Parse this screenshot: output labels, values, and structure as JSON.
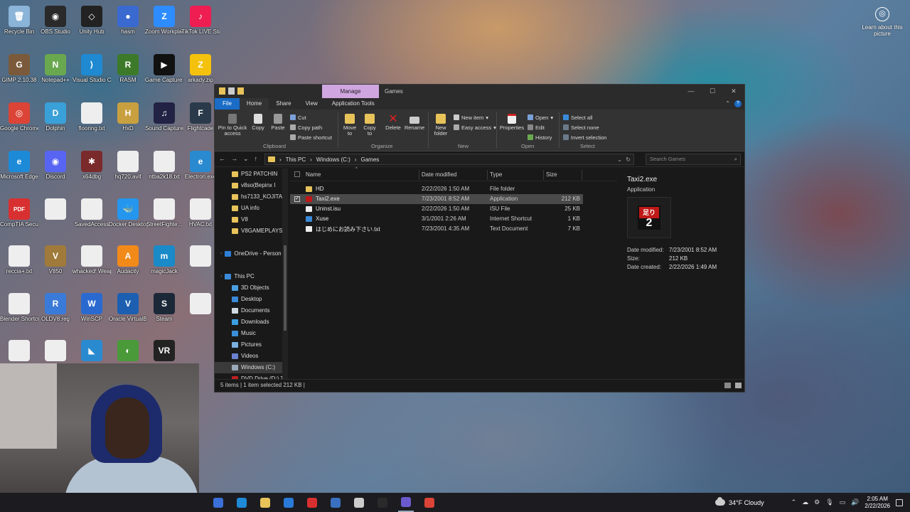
{
  "desktop": {
    "icons": [
      {
        "label": "Recycle Bin",
        "color": "#8ab4d8",
        "glyph": "🗑"
      },
      {
        "label": "OBS Studio",
        "color": "#2a2a2a",
        "glyph": "◉"
      },
      {
        "label": "Unity Hub",
        "color": "#222222",
        "glyph": "◇"
      },
      {
        "label": "hasm",
        "color": "#3a6ad0",
        "glyph": "●"
      },
      {
        "label": "Zoom Workplace",
        "color": "#2d8cff",
        "glyph": "Z"
      },
      {
        "label": "TikTok LIVE Studio",
        "color": "#ee1d52",
        "glyph": "♪"
      },
      {
        "label": "GIMP 2.10.38",
        "color": "#7a5a3a",
        "glyph": "G"
      },
      {
        "label": "Notepad++",
        "color": "#6aa84f",
        "glyph": "N"
      },
      {
        "label": "Visual Studio Code",
        "color": "#1f8ad2",
        "glyph": "⟩"
      },
      {
        "label": "RASM",
        "color": "#3c7a2a",
        "glyph": "R"
      },
      {
        "label": "Game Capture HD",
        "color": "#111111",
        "glyph": "▶"
      },
      {
        "label": "arkady.zip",
        "color": "#f4c20d",
        "glyph": "Z"
      },
      {
        "label": "Google Chrome",
        "color": "#db4437",
        "glyph": "◎"
      },
      {
        "label": "Dolphin",
        "color": "#3aa0d8",
        "glyph": "D"
      },
      {
        "label": "flooring.txt",
        "color": "#eeeeee",
        "glyph": ""
      },
      {
        "label": "HxD",
        "color": "#c8a040",
        "glyph": "H"
      },
      {
        "label": "Sound Capture",
        "color": "#222244",
        "glyph": "♫"
      },
      {
        "label": "Flightcade",
        "color": "#2a3a4a",
        "glyph": "F"
      },
      {
        "label": "Microsoft Edge",
        "color": "#1d8ad8",
        "glyph": "e"
      },
      {
        "label": "Discord",
        "color": "#5865f2",
        "glyph": "◉"
      },
      {
        "label": "x64dbg",
        "color": "#7a2a2a",
        "glyph": "✱"
      },
      {
        "label": "hq720.avif",
        "color": "#eeeeee",
        "glyph": ""
      },
      {
        "label": "ntba2k18.txt",
        "color": "#eeeeee",
        "glyph": ""
      },
      {
        "label": "Electron.exe",
        "color": "#2a8ad0",
        "glyph": "e"
      },
      {
        "label": "CompTIA Security...",
        "color": "#d83030",
        "glyph": "PDF"
      },
      {
        "label": "",
        "color": "#eeeeee",
        "glyph": ""
      },
      {
        "label": "SavedAccess",
        "color": "#eeeeee",
        "glyph": ""
      },
      {
        "label": "Docker Desktop",
        "color": "#2496ed",
        "glyph": "🐳"
      },
      {
        "label": "StreetFighte...",
        "color": "#eeeeee",
        "glyph": ""
      },
      {
        "label": "HVAC.txt",
        "color": "#eeeeee",
        "glyph": ""
      },
      {
        "label": "reccia+.txt",
        "color": "#eeeeee",
        "glyph": ""
      },
      {
        "label": "V850",
        "color": "#a07a3a",
        "glyph": "V"
      },
      {
        "label": "whacked! Weapon...",
        "color": "#eeeeee",
        "glyph": ""
      },
      {
        "label": "Audacity",
        "color": "#f28a1a",
        "glyph": "A"
      },
      {
        "label": "magicJack",
        "color": "#1a8ac8",
        "glyph": "m"
      },
      {
        "label": "",
        "color": "#eeeeee",
        "glyph": ""
      },
      {
        "label": "Blender Shortcut.txt",
        "color": "#eeeeee",
        "glyph": ""
      },
      {
        "label": "OLDV8.reg",
        "color": "#3a7ad8",
        "glyph": "R"
      },
      {
        "label": "WinSCP",
        "color": "#2a6ad0",
        "glyph": "W"
      },
      {
        "label": "Oracle VirtualBox",
        "color": "#1c5fb0",
        "glyph": "V"
      },
      {
        "label": "Steam",
        "color": "#1b2838",
        "glyph": "S"
      },
      {
        "label": "",
        "color": "#eeeeee",
        "glyph": ""
      },
      {
        "label": "",
        "color": "#eeeeee",
        "glyph": ""
      },
      {
        "label": "",
        "color": "#eeeeee",
        "glyph": ""
      },
      {
        "label": "",
        "color": "#2a8ad0",
        "glyph": "◣"
      },
      {
        "label": "",
        "color": "#4a9a3a",
        "glyph": "◐"
      },
      {
        "label": "",
        "color": "#222222",
        "glyph": "VR"
      }
    ],
    "learn_label": "Learn about this picture"
  },
  "window": {
    "title": "Games",
    "manage_tab": "Manage",
    "controls": {
      "min": "—",
      "max": "☐",
      "close": "✕"
    },
    "tabs": [
      "File",
      "Home",
      "Share",
      "View",
      "Application Tools"
    ],
    "ribbon": {
      "pin": "Pin to Quick access",
      "copy": "Copy",
      "paste": "Paste",
      "cut": "Cut",
      "copy_path": "Copy path",
      "paste_shortcut": "Paste shortcut",
      "clipboard": "Clipboard",
      "move_to": "Move to",
      "copy_to": "Copy to",
      "delete": "Delete",
      "rename": "Rename",
      "organize": "Organize",
      "new_folder": "New folder",
      "new_item": "New item",
      "easy_access": "Easy access",
      "new": "New",
      "properties": "Properties",
      "open": "Open",
      "edit": "Edit",
      "history": "History",
      "open_grp": "Open",
      "select_all": "Select all",
      "select_none": "Select none",
      "invert": "Invert selection",
      "select": "Select"
    },
    "address": {
      "crumbs": [
        "This PC",
        "Windows (C:)",
        "Games"
      ],
      "search_placeholder": "Search Games"
    },
    "nav_items": [
      {
        "label": "PS2 PATCHIN",
        "icon": "#e8c35a",
        "indent": 20,
        "sel": false
      },
      {
        "label": "v8so(Bepinx I",
        "icon": "#e8c35a",
        "indent": 20,
        "sel": false
      },
      {
        "label": "hs7133_KOJITAXI",
        "icon": "#e8c35a",
        "indent": 20,
        "sel": false
      },
      {
        "label": "UA info",
        "icon": "#e8c35a",
        "indent": 20,
        "sel": false
      },
      {
        "label": "V8",
        "icon": "#e8c35a",
        "indent": 20,
        "sel": false
      },
      {
        "label": "V8GAMEPLAYS",
        "icon": "#e8c35a",
        "indent": 20,
        "sel": false
      },
      {
        "label": "",
        "icon": "",
        "indent": 8,
        "sel": false
      },
      {
        "label": "OneDrive - Person",
        "icon": "#2f7fd8",
        "indent": 8,
        "sel": false
      },
      {
        "label": "",
        "icon": "",
        "indent": 8,
        "sel": false
      },
      {
        "label": "This PC",
        "icon": "#3a8ad8",
        "indent": 8,
        "sel": false
      },
      {
        "label": "3D Objects",
        "icon": "#4aa0e0",
        "indent": 20,
        "sel": false
      },
      {
        "label": "Desktop",
        "icon": "#3a88d8",
        "indent": 20,
        "sel": false
      },
      {
        "label": "Documents",
        "icon": "#cfd8e0",
        "indent": 20,
        "sel": false
      },
      {
        "label": "Downloads",
        "icon": "#3aa0e0",
        "indent": 20,
        "sel": false
      },
      {
        "label": "Music",
        "icon": "#3a90d8",
        "indent": 20,
        "sel": false
      },
      {
        "label": "Pictures",
        "icon": "#7ab0e0",
        "indent": 20,
        "sel": false
      },
      {
        "label": "Videos",
        "icon": "#6a80d0",
        "indent": 20,
        "sel": false
      },
      {
        "label": "Windows (C:)",
        "icon": "#9aa8b8",
        "indent": 20,
        "sel": true
      },
      {
        "label": "DVD Drive (D:) T",
        "icon": "#c02020",
        "indent": 20,
        "sel": false
      },
      {
        "label": "",
        "icon": "",
        "indent": 8,
        "sel": false
      },
      {
        "label": "Network",
        "icon": "#3a8ad8",
        "indent": 8,
        "sel": false
      }
    ],
    "columns": [
      "Name",
      "Date modified",
      "Type",
      "Size"
    ],
    "files": [
      {
        "name": "HD",
        "date": "2/22/2026 1:50 AM",
        "type": "File folder",
        "size": "",
        "icon": "#e8c35a",
        "sel": false
      },
      {
        "name": "Taxi2.exe",
        "date": "7/23/2001 8:52 AM",
        "type": "Application",
        "size": "212 KB",
        "icon": "#c01818",
        "sel": true
      },
      {
        "name": "Uninst.isu",
        "date": "2/22/2026 1:50 AM",
        "type": "ISU File",
        "size": "25 KB",
        "icon": "#eeeeee",
        "sel": false
      },
      {
        "name": "Xuse",
        "date": "3/1/2001 2:26 AM",
        "type": "Internet Shortcut",
        "size": "1 KB",
        "icon": "#3a8ad8",
        "sel": false
      },
      {
        "name": "はじめにお読み下さい.txt",
        "date": "7/23/2001 4:35 AM",
        "type": "Text Document",
        "size": "7 KB",
        "icon": "#eeeeee",
        "sel": false
      }
    ],
    "preview": {
      "name": "Taxi2.exe",
      "type": "Application",
      "logo_top": "足り",
      "logo_num": "2",
      "meta": [
        {
          "k": "Date modified:",
          "v": "7/23/2001 8:52 AM"
        },
        {
          "k": "Size:",
          "v": "212 KB"
        },
        {
          "k": "Date created:",
          "v": "2/22/2026 1:49 AM"
        }
      ]
    },
    "status": "5 items  |  1 item selected  212 KB  |"
  },
  "taskbar": {
    "apps": [
      {
        "color": "#3a70d8",
        "active": false
      },
      {
        "color": "#1f8ad8",
        "active": false
      },
      {
        "color": "#e8c35a",
        "active": false
      },
      {
        "color": "#2a7ad8",
        "active": false
      },
      {
        "color": "#d83030",
        "active": false
      },
      {
        "color": "#3a70c0",
        "active": false
      },
      {
        "color": "#cccccc",
        "active": false
      },
      {
        "color": "#2a2a2a",
        "active": false
      },
      {
        "color": "#6a5acd",
        "active": true
      },
      {
        "color": "#db4437",
        "active": false
      }
    ],
    "weather": "34°F  Cloudy",
    "time": "2:05 AM",
    "date": "2/22/2026"
  }
}
